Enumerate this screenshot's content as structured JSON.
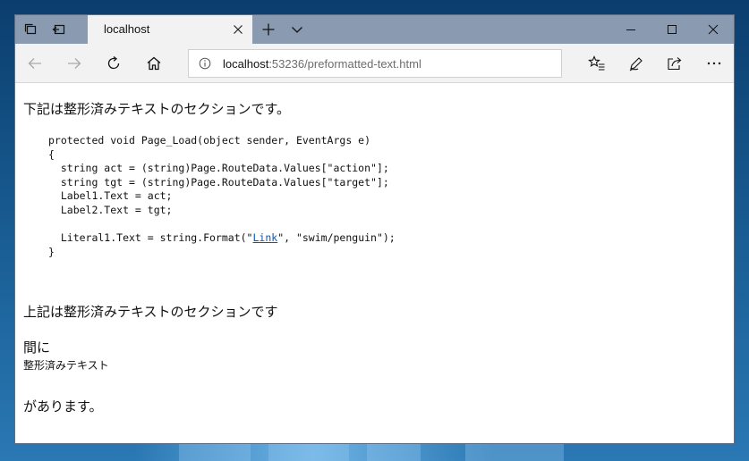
{
  "browser": {
    "tab": {
      "title": "localhost"
    },
    "address": {
      "host": "localhost",
      "rest": ":53236/preformatted-text.html"
    },
    "icons": {
      "tab_manager": "tab-manager-icon",
      "set_aside": "set-aside-tabs-icon",
      "close_tab": "close-icon",
      "new_tab": "plus-icon",
      "tab_preview": "chevron-down-icon",
      "minimize": "minimize-icon",
      "maximize": "maximize-icon",
      "close_window": "close-icon",
      "back": "back-arrow-icon",
      "forward": "forward-arrow-icon",
      "refresh": "refresh-icon",
      "home": "home-icon",
      "info": "info-icon",
      "favorites": "favorites-icon",
      "notes": "pen-icon",
      "share": "share-icon",
      "more": "more-icon"
    },
    "colors": {
      "titlebar": "#8a9ab0",
      "tab": "#f2f2f2",
      "toolbar": "#f2f2f2",
      "link": "#0b57b0"
    }
  },
  "page": {
    "intro": "下記は整形済みテキストのセクションです。",
    "code": {
      "line1": "protected void Page_Load(object sender, EventArgs e)",
      "line2": "{",
      "line3": "  string act = (string)Page.RouteData.Values[\"action\"];",
      "line4": "  string tgt = (string)Page.RouteData.Values[\"target\"];",
      "line5": "  Label1.Text = act;",
      "line6": "  Label2.Text = tgt;",
      "line7": "",
      "line8_before": "  Literal1.Text = string.Format(\"",
      "line8_link": "Link",
      "line8_after": "\", \"swim/penguin\");",
      "line9": "}"
    },
    "after_code": "上記は整形済みテキストのセクションです",
    "between": "間に",
    "preformatted": "整形済みテキスト",
    "ending": "があります。"
  }
}
